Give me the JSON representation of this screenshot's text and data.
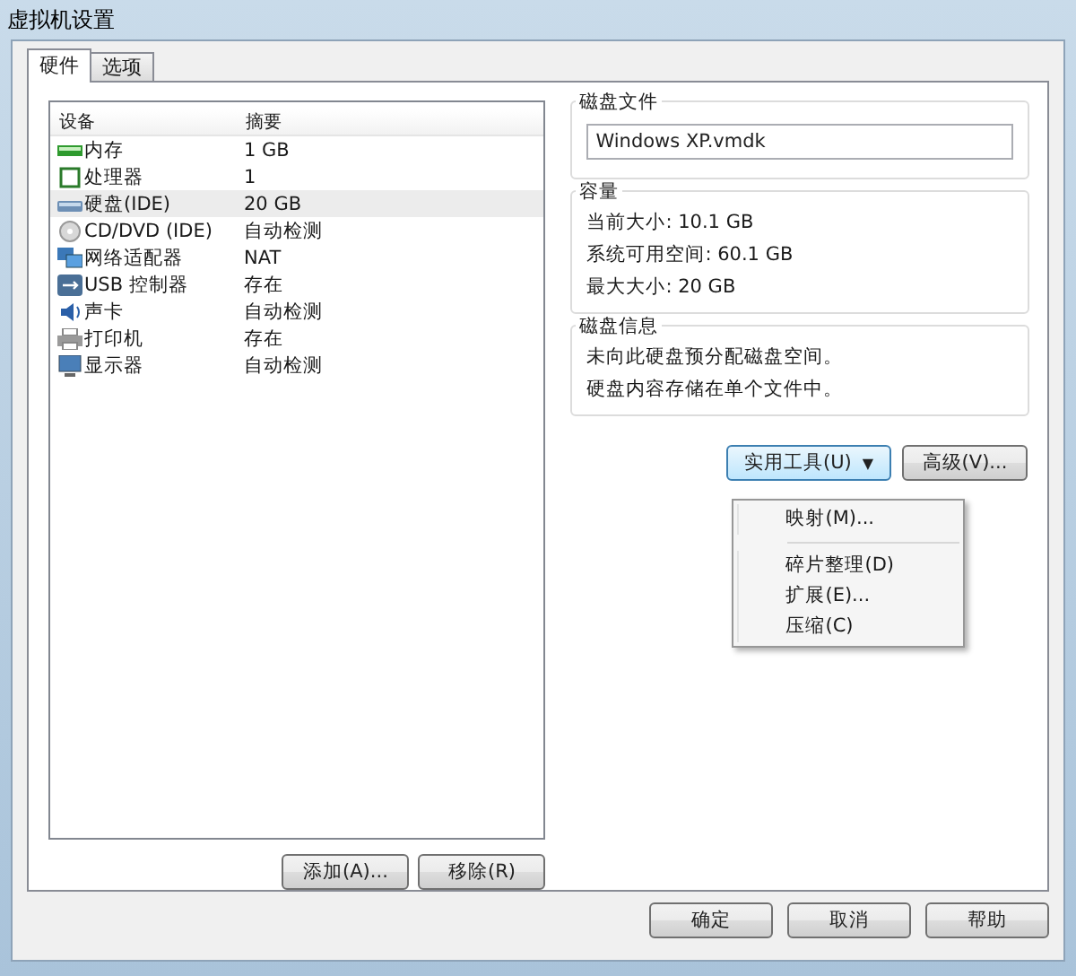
{
  "window": {
    "title": "虚拟机设置"
  },
  "tabs": [
    {
      "label": "硬件",
      "selected": true
    },
    {
      "label": "选项",
      "selected": false
    }
  ],
  "device_list": {
    "columns": [
      "设备",
      "摘要"
    ],
    "rows": [
      {
        "kind": "memory",
        "device": "内存",
        "summary": "1 GB",
        "selected": false
      },
      {
        "kind": "cpu",
        "device": "处理器",
        "summary": "1",
        "selected": false
      },
      {
        "kind": "disk",
        "device": "硬盘(IDE)",
        "summary": "20 GB",
        "selected": true
      },
      {
        "kind": "cdrom",
        "device": "CD/DVD (IDE)",
        "summary": "自动检测",
        "selected": false
      },
      {
        "kind": "network",
        "device": "网络适配器",
        "summary": "NAT",
        "selected": false
      },
      {
        "kind": "usb",
        "device": "USB 控制器",
        "summary": "存在",
        "selected": false
      },
      {
        "kind": "sound",
        "device": "声卡",
        "summary": "自动检测",
        "selected": false
      },
      {
        "kind": "printer",
        "device": "打印机",
        "summary": "存在",
        "selected": false
      },
      {
        "kind": "display",
        "device": "显示器",
        "summary": "自动检测",
        "selected": false
      }
    ]
  },
  "list_buttons": [
    "添加(A)...",
    "移除(R)"
  ],
  "disk_file": {
    "title": "磁盘文件",
    "value": "Windows XP.vmdk"
  },
  "capacity": {
    "title": "容量",
    "lines": [
      "当前大小: 10.1 GB",
      "系统可用空间: 60.1 GB",
      "最大大小: 20 GB"
    ]
  },
  "disk_info": {
    "title": "磁盘信息",
    "lines": [
      "未向此硬盘预分配磁盘空间。",
      "硬盘内容存储在单个文件中。"
    ]
  },
  "utilities_button": {
    "label": "实用工具(U)",
    "arrow": "▼",
    "open": true
  },
  "advanced_button": "高级(V)...",
  "utilities_menu": [
    {
      "kind": "item",
      "label": "映射(M)..."
    },
    {
      "kind": "separator"
    },
    {
      "kind": "item",
      "label": "碎片整理(D)"
    },
    {
      "kind": "item",
      "label": "扩展(E)..."
    },
    {
      "kind": "item",
      "label": "压缩(C)"
    }
  ],
  "dialog_buttons": [
    "确定",
    "取消",
    "帮助"
  ]
}
